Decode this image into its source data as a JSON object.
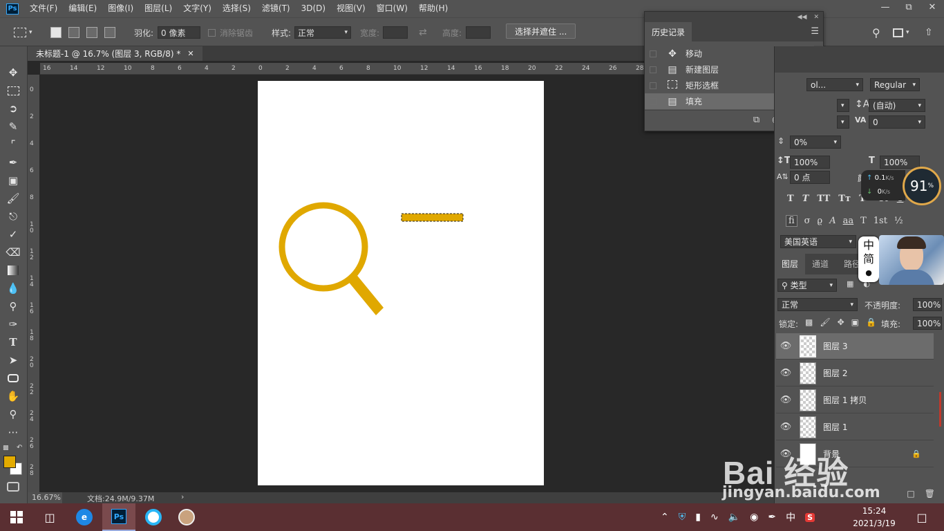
{
  "app": {
    "logo": "Ps"
  },
  "menu": [
    "文件(F)",
    "编辑(E)",
    "图像(I)",
    "图层(L)",
    "文字(Y)",
    "选择(S)",
    "滤镜(T)",
    "3D(D)",
    "视图(V)",
    "窗口(W)",
    "帮助(H)"
  ],
  "options": {
    "feather_label": "羽化:",
    "feather_value": "0 像素",
    "antialias_label": "消除锯齿",
    "style_label": "样式:",
    "style_value": "正常",
    "width_label": "宽度:",
    "height_label": "高度:",
    "select_mask_button": "选择并遮住 ..."
  },
  "document": {
    "tab_title": "未标题-1 @ 16.7% (图层 3, RGB/8) *",
    "zoom": "16.67%",
    "doc_size": "文档:24.9M/9.37M"
  },
  "ruler_top": [
    "16",
    "14",
    "12",
    "10",
    "8",
    "6",
    "4",
    "2",
    "0",
    "2",
    "4",
    "6",
    "8",
    "10",
    "12",
    "14",
    "16",
    "18",
    "20",
    "22",
    "24",
    "26",
    "28"
  ],
  "ruler_left": [
    "0",
    "2",
    "4",
    "6",
    "8",
    "10",
    "12",
    "14",
    "16",
    "18",
    "20",
    "22",
    "24",
    "26",
    "28"
  ],
  "history": {
    "title": "历史记录",
    "items": [
      {
        "label": "移动",
        "icon": "move-icon"
      },
      {
        "label": "新建图层",
        "icon": "new-layer-icon"
      },
      {
        "label": "矩形选框",
        "icon": "marquee-icon"
      },
      {
        "label": "填充",
        "icon": "fill-icon"
      }
    ]
  },
  "character": {
    "font_family": "ol...",
    "font_style": "Regular",
    "leading": "(自动)",
    "tracking": "0",
    "vscale_pct": "0%",
    "size_v": "100%",
    "size_h": "100%",
    "baseline": "0 点",
    "language": "美国英语",
    "color_label": "颜"
  },
  "net_widget": {
    "up": "0.1",
    "down": "0",
    "unit": "K/s",
    "cpu": "91",
    "cpu_unit": "%"
  },
  "ime": {
    "line1": "中",
    "line2": "简"
  },
  "layers_panel": {
    "tabs": [
      "图层",
      "通道",
      "路径"
    ],
    "filter_label": "类型",
    "blend_mode": "正常",
    "opacity_label": "不透明度:",
    "opacity_value": "100%",
    "lock_label": "锁定:",
    "fill_label": "填充:",
    "fill_value": "100%",
    "layers": [
      {
        "name": "图层 3",
        "selected": true
      },
      {
        "name": "图层 2",
        "selected": false
      },
      {
        "name": "图层 1 拷贝",
        "selected": false
      },
      {
        "name": "图层 1",
        "selected": false
      },
      {
        "name": "背景",
        "selected": false
      }
    ]
  },
  "colors": {
    "foreground": "#e3ab00",
    "background": "#ffffff",
    "art": "#e0a800"
  },
  "watermark": {
    "brand": "Bai 经验",
    "url": "jingyan.baidu.com"
  },
  "taskbar": {
    "time": "15:24",
    "date": "2021/3/19",
    "ime": "中"
  }
}
